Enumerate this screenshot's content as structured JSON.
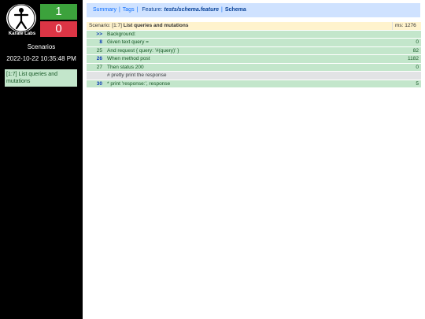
{
  "sidebar": {
    "logo_text": "Karate Labs",
    "passed_count": "1",
    "failed_count": "0",
    "title": "Scenarios",
    "timestamp": "2022-10-22 10:35:48 PM",
    "scenarios": [
      {
        "label": "[1:7] List queries and mutations"
      }
    ]
  },
  "nav": {
    "summary": "Summary",
    "tags": "Tags",
    "feature_label": "Feature:",
    "feature_path": "tests/schema.feature",
    "feature_name": "Schema"
  },
  "scenario": {
    "prefix": "Scenario: [1:7]",
    "name": "List queries and mutations",
    "ms": "ms: 1276",
    "steps": [
      {
        "line": ">>",
        "text": "Background:",
        "ms": "",
        "kind": "pass",
        "bold": true
      },
      {
        "line": "8",
        "text": "Given text query =",
        "ms": "0",
        "kind": "pass",
        "bold": true
      },
      {
        "line": "25",
        "text": "And request { query: '#(query)' }",
        "ms": "82",
        "kind": "pass",
        "bold": false
      },
      {
        "line": "26",
        "text": "When method post",
        "ms": "1182",
        "kind": "pass",
        "bold": true
      },
      {
        "line": "27",
        "text": "Then status 200",
        "ms": "0",
        "kind": "pass",
        "bold": false
      },
      {
        "line": "",
        "text": "# pretty print the response",
        "ms": "",
        "kind": "comment",
        "bold": false
      },
      {
        "line": "30",
        "text": "* print 'response:', response",
        "ms": "5",
        "kind": "pass",
        "bold": true
      }
    ]
  },
  "colors": {
    "passed": "#3ca23c",
    "failed": "#dc3545",
    "step_pass_bg": "#c3e6cb",
    "scenario_header_bg": "#fff3cd",
    "nav_bg": "#cfe2ff"
  }
}
